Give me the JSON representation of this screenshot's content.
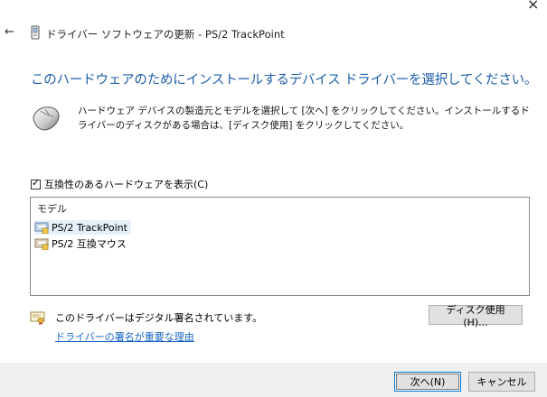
{
  "window": {
    "title": "ドライバー ソフトウェアの更新 - PS/2 TrackPoint",
    "close_glyph": "×",
    "back_glyph": "←"
  },
  "main": {
    "heading": "このハードウェアのためにインストールするデバイス ドライバーを選択してください。",
    "instructions": "ハードウェア デバイスの製造元とモデルを選択して [次へ] をクリックしてください。インストールするドライバーのディスクがある場合は、[ディスク使用] をクリックしてください。"
  },
  "compatible_checkbox": {
    "label": "互換性のあるハードウェアを表示(C)",
    "checked": true,
    "check_glyph": "✓"
  },
  "model_list": {
    "header": "モデル",
    "items": [
      {
        "label": "PS/2 TrackPoint",
        "selected": true
      },
      {
        "label": "PS/2 互換マウス",
        "selected": false
      }
    ]
  },
  "signature": {
    "status_text": "このドライバーはデジタル署名されています。",
    "link_text": "ドライバーの署名が重要な理由"
  },
  "buttons": {
    "have_disk": "ディスク使用(H)...",
    "next": "次へ(N)",
    "cancel": "キャンセル"
  },
  "colors": {
    "heading": "#1f5fa8",
    "link": "#1a66c4",
    "selection": "#e5f0fb",
    "focus_border": "#0078d7"
  },
  "icons": {
    "title": "device-manager-icon",
    "mouse": "mouse-icon",
    "driver": "driver-package-icon",
    "certificate": "certificate-icon"
  }
}
